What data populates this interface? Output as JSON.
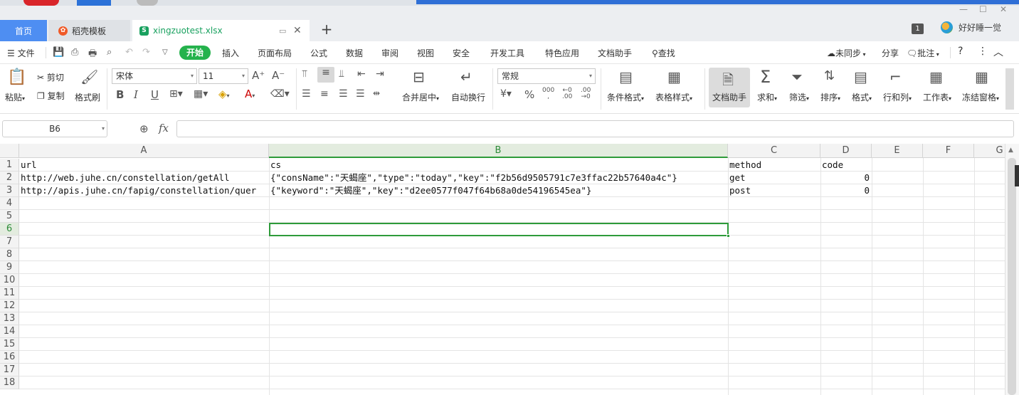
{
  "tabs": {
    "home": "首页",
    "template": "稻壳模板",
    "file": "xingzuotest.xlsx"
  },
  "top_right": {
    "badge": "1",
    "user_name": "好好睡一觉"
  },
  "menu": {
    "file": "文件",
    "start": "开始",
    "items": [
      "插入",
      "页面布局",
      "公式",
      "数据",
      "审阅",
      "视图",
      "安全",
      "开发工具",
      "特色应用",
      "文档助手"
    ],
    "search": "查找",
    "sync": "未同步",
    "share": "分享",
    "comment": "批注",
    "help": "?"
  },
  "ribbon": {
    "paste": "粘贴",
    "cut": "剪切",
    "copy": "复制",
    "format_painter": "格式刷",
    "font_name": "宋体",
    "font_size": "11",
    "merge_center": "合并居中",
    "wrap_text": "自动换行",
    "number_format": "常规",
    "cond_format": "条件格式",
    "table_style": "表格样式",
    "doc_assist": "文档助手",
    "sum": "求和",
    "filter": "筛选",
    "sort": "排序",
    "format": "格式",
    "row_col": "行和列",
    "worksheet": "工作表",
    "freeze": "冻结窗格"
  },
  "formula_bar": {
    "name_box": "B6",
    "fx": "fx",
    "value": ""
  },
  "sheet": {
    "columns": [
      "A",
      "B",
      "C",
      "D",
      "E",
      "F",
      "G"
    ],
    "selected_column": "B",
    "rows": [
      "1",
      "2",
      "3",
      "4",
      "5",
      "6",
      "7",
      "8",
      "9",
      "10",
      "11",
      "12",
      "13",
      "14",
      "15",
      "16",
      "17",
      "18"
    ],
    "selected_row": "6",
    "active_cell": "B6",
    "cells": {
      "A1": "url",
      "B1": "cs",
      "C1": "method",
      "D1": "code",
      "A2": "http://web.juhe.cn/constellation/getAll",
      "B2": "{\"consName\":\"天蝎座\",\"type\":\"today\",\"key\":\"f2b56d9505791c7e3ffac22b57640a4c\"}",
      "C2": "get",
      "D2": "0",
      "A3": "http://apis.juhe.cn/fapig/constellation/quer",
      "B3": "{\"keyword\":\"天蝎座\",\"key\":\"d2ee0577f047f64b68a0de54196545ea\"}",
      "C3": "post",
      "D3": "0"
    }
  },
  "colors": {
    "accent_green": "#2e9b3a",
    "start_green": "#24b24c",
    "home_tab_blue": "#4e8ef2"
  }
}
